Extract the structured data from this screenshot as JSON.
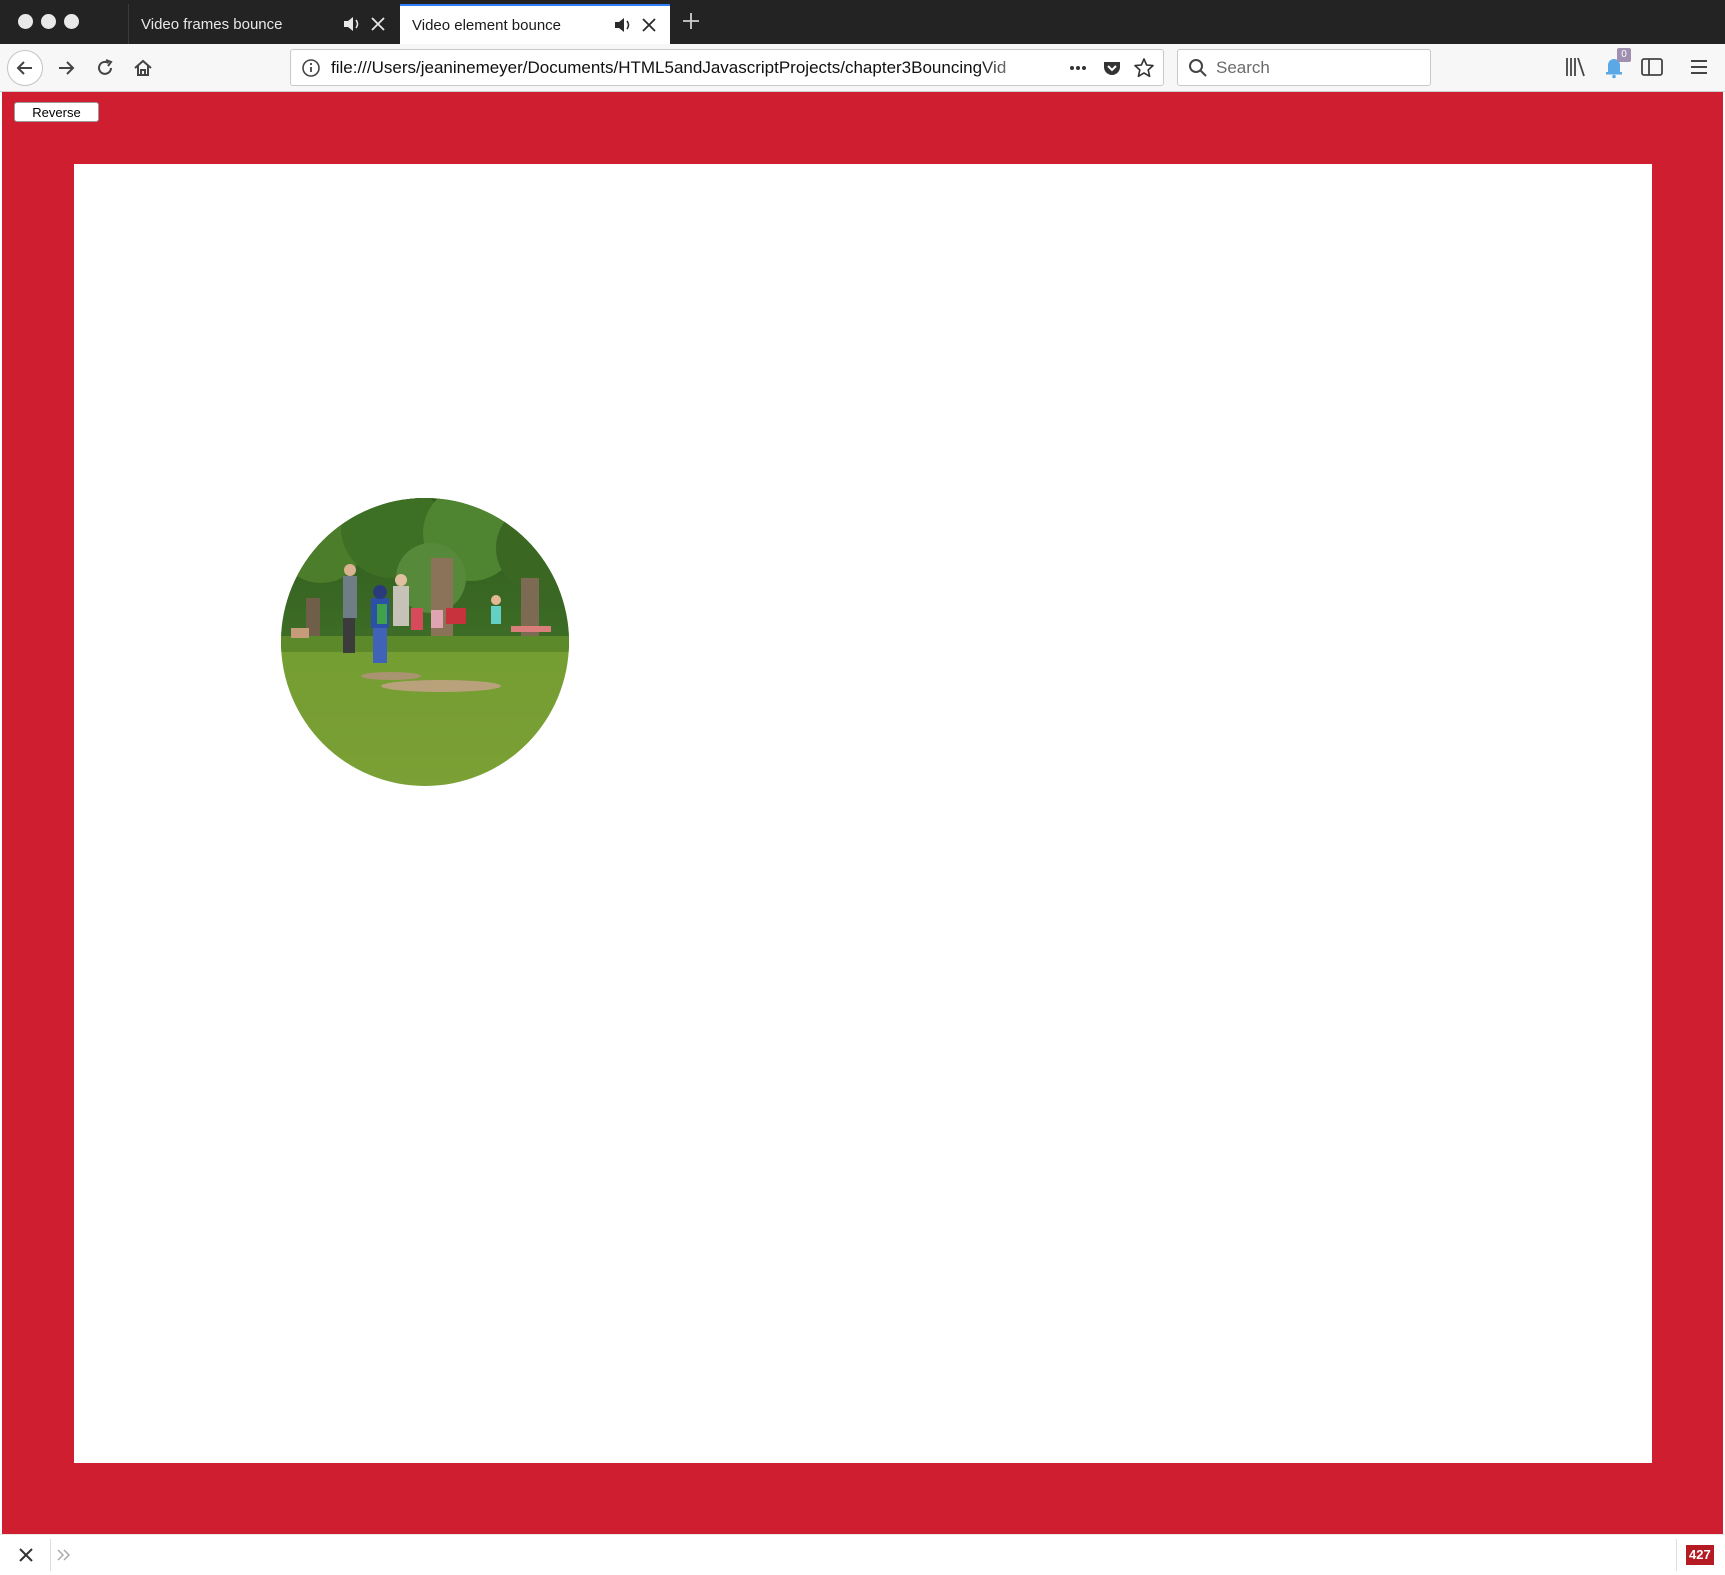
{
  "tabs": [
    {
      "title": "Video frames bounce",
      "active": false
    },
    {
      "title": "Video element bounce",
      "active": true
    }
  ],
  "toolbar": {
    "url": "file:///Users/jeaninemeyer/Documents/HTML5andJavascriptProjects/chapter3BouncingVid",
    "search_placeholder": "Search",
    "notification_badge": "0"
  },
  "content": {
    "reverse_label": "Reverse",
    "background_color": "#ce1e2f",
    "canvas_color": "#ffffff"
  },
  "statusbar": {
    "counter": "427"
  }
}
